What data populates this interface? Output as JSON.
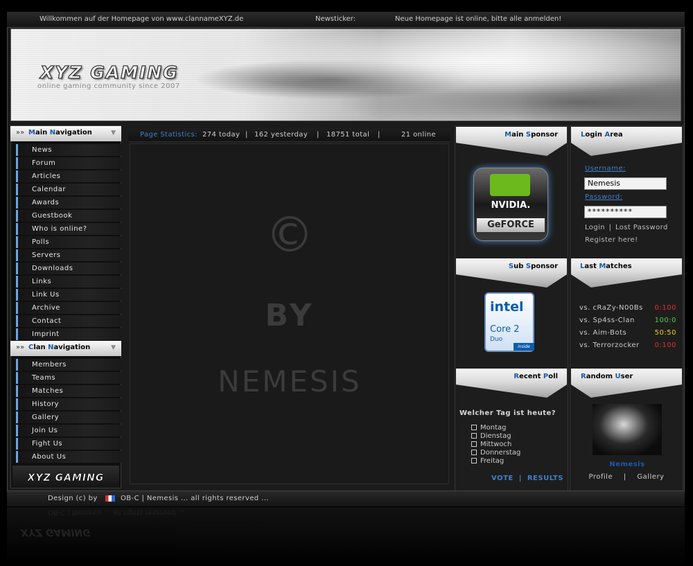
{
  "topbar": {
    "welcome": "Willkommen auf der Homepage von www.clannameXYZ.de",
    "ticker_label": "Newsticker:",
    "ticker_text": "Neue Homepage ist online, bitte alle anmelden!"
  },
  "header": {
    "title": "XYZ GAMING",
    "subtitle": "online gaming community since 2007"
  },
  "main_nav": {
    "title_initial": "M",
    "title_rest": "ain ",
    "title_initial2": "N",
    "title_rest2": "avigation",
    "items": [
      "News",
      "Forum",
      "Articles",
      "Calendar",
      "Awards",
      "Guestbook",
      "Who is online?",
      "Polls",
      "Servers",
      "Downloads",
      "Links",
      "Link Us",
      "Archive",
      "Contact",
      "Imprint"
    ]
  },
  "clan_nav": {
    "title_initial": "C",
    "title_rest": "lan ",
    "title_initial2": "N",
    "title_rest2": "avigation",
    "items": [
      "Members",
      "Teams",
      "Matches",
      "History",
      "Gallery",
      "Join Us",
      "Fight Us",
      "About Us"
    ]
  },
  "left_logo": "XYZ GAMING",
  "stats": {
    "label": "Page Statistics:",
    "today": "274 today",
    "sep1": "|",
    "yesterday": "162 yesterday",
    "sep2": "|",
    "total": "18751 total",
    "sep3": "|",
    "online": "21 online"
  },
  "content": {
    "copyright_symbol": "©",
    "by": "BY",
    "author": "NEMESIS"
  },
  "main_sponsor": {
    "title_initial": "M",
    "title_rest": "ain ",
    "title_initial2": "S",
    "title_rest2": "ponsor",
    "brand_top": "NVIDIA.",
    "brand_bottom": "GeFORCE"
  },
  "sub_sponsor": {
    "title_initial": "S",
    "title_rest": "ub ",
    "title_initial2": "S",
    "title_rest2": "ponsor",
    "brand": "intel",
    "product": "Core 2",
    "product_sub": "Duo",
    "tag": "inside"
  },
  "recent_poll": {
    "title_initial": "R",
    "title_rest": "ecent ",
    "title_initial2": "P",
    "title_rest2": "oll",
    "question": "Welcher Tag ist heute?",
    "options": [
      "Montag",
      "Dienstag",
      "Mittwoch",
      "Donnerstag",
      "Freitag"
    ],
    "vote": "VOTE",
    "sep": "|",
    "results": "RESULTS"
  },
  "login": {
    "title_initial": "L",
    "title_rest": "ogin ",
    "title_initial2": "A",
    "title_rest2": "rea",
    "username_label": "Username:",
    "username_value": "Nemesis",
    "password_label": "Password:",
    "password_value": "**********",
    "login_link": "Login",
    "sep": "|",
    "lost_link": "Lost Password",
    "register_link": "Register here!"
  },
  "last_matches": {
    "title_initial": "L",
    "title_rest": "ast ",
    "title_initial2": "M",
    "title_rest2": "atches",
    "rows": [
      {
        "opponent": "vs. cRaZy-N00Bs",
        "score": "0:100",
        "color": "#e03030"
      },
      {
        "opponent": "vs. Sp4ss-Clan",
        "score": "100:0",
        "color": "#4fd04f"
      },
      {
        "opponent": "vs. Aim-Bots",
        "score": "50:50",
        "color": "#f0d020"
      },
      {
        "opponent": "vs. Terrorzocker",
        "score": "0:100",
        "color": "#e03030"
      }
    ]
  },
  "random_user": {
    "title_initial": "R",
    "title_rest": "andom ",
    "title_initial2": "U",
    "title_rest2": "ser",
    "name": "Nemesis",
    "profile": "Profile",
    "sep": "|",
    "gallery": "Gallery"
  },
  "footer": {
    "design_by": "Design (c) by",
    "credit": "OB-C | Nemesis ... all rights reserved ..."
  },
  "colors": {
    "accent": "#1c5aa8",
    "link": "#3d80cc",
    "background": "#000000"
  }
}
